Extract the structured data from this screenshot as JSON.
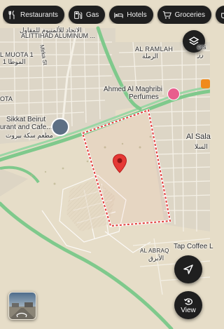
{
  "filter_chips": [
    {
      "label": "Restaurants",
      "icon": "fork-knife-icon"
    },
    {
      "label": "Gas",
      "icon": "gas-pump-icon"
    },
    {
      "label": "Hotels",
      "icon": "bed-icon"
    },
    {
      "label": "Groceries",
      "icon": "shopping-cart-icon"
    },
    {
      "label": "Co",
      "icon": "coffee-icon"
    }
  ],
  "map_labels": {
    "alithihad_ar": "الاتحاد للألمنيوم للمقاول",
    "alithihad_en": "ALITTIHAD ALUMINUM ...",
    "muota_en": "L MUOTA 1",
    "muota_ar": "1 الموطا",
    "mirka_st": "Mirka St",
    "ramlah_en": "AL RAMLAH",
    "ramlah_ar": "الرملة",
    "ahmed_line1": "Ahmed Al Maghribi",
    "ahmed_line2": "Perfumes",
    "ers": "ers",
    "ers_ar": "رز",
    "ota": "OTA",
    "sikkat_line1": "Sikkat Beirut",
    "sikkat_line2": "urant and Cafe...",
    "sikkat_ar": "مطعم سكة بيروت",
    "al_sala": "Al Sala",
    "sala_ar": "السلا",
    "al_abraq_en": "AL ABRAQ",
    "al_abraq_ar": "الأبرق",
    "tap_coffee": "Tap Coffee L"
  },
  "controls": {
    "view_label": "View",
    "layers_icon": "layers-icon",
    "navigation_icon": "navigation-arrow-icon",
    "rotate_icon": "rotate-icon"
  },
  "colors": {
    "land": "#e6ddc8",
    "main_road": "#7fc98c",
    "boundary": "#e23b3b",
    "pin": "#e53935",
    "chip_bg": "#1f1f1f"
  }
}
